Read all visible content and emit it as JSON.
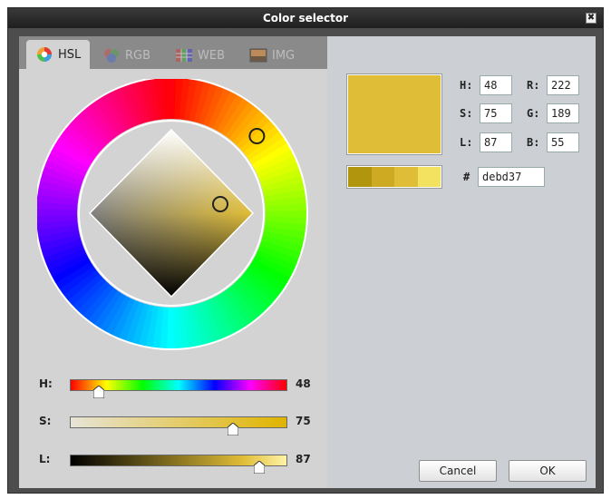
{
  "window": {
    "title": "Color selector",
    "close_glyph": "✖"
  },
  "tabs": [
    {
      "label": "HSL",
      "icon": "hsl-wheel-icon",
      "active": true
    },
    {
      "label": "RGB",
      "icon": "rgb-circles-icon",
      "active": false
    },
    {
      "label": "WEB",
      "icon": "web-grid-icon",
      "active": false
    },
    {
      "label": "IMG",
      "icon": "image-icon",
      "active": false
    }
  ],
  "sliders": {
    "h": {
      "label": "H:",
      "value": "48",
      "fraction": 0.133
    },
    "s": {
      "label": "S:",
      "value": "75",
      "fraction": 0.75
    },
    "l": {
      "label": "L:",
      "value": "87",
      "fraction": 0.87
    }
  },
  "fields": {
    "h": {
      "label": "H:",
      "value": "48"
    },
    "s": {
      "label": "S:",
      "value": "75"
    },
    "l": {
      "label": "L:",
      "value": "87"
    },
    "r": {
      "label": "R:",
      "value": "222"
    },
    "g": {
      "label": "G:",
      "value": "189"
    },
    "b": {
      "label": "B:",
      "value": "55"
    },
    "hex": {
      "label": "#",
      "value": "debd37"
    }
  },
  "colors": {
    "selected": "#e0bd37",
    "shades": [
      "#b1960d",
      "#cdaa21",
      "#e0bd37",
      "#f3e160"
    ]
  },
  "buttons": {
    "cancel": "Cancel",
    "ok": "OK"
  }
}
